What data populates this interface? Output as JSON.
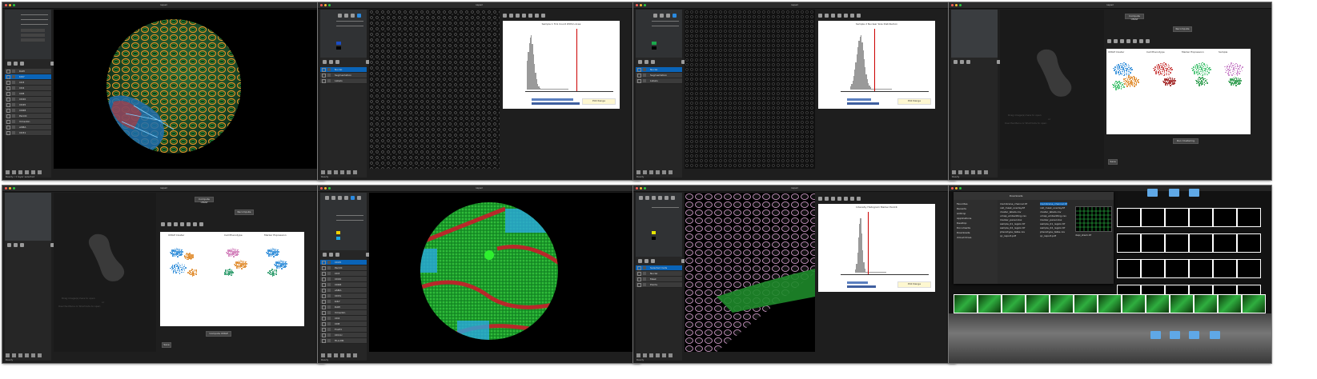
{
  "windows": [
    {
      "title": "napari",
      "status": "Ready / 1 layer selected",
      "layers": [
        "DAPI",
        "Ki67",
        "CD3",
        "CD4",
        "CD8",
        "CD20",
        "CD45",
        "CD68",
        "PanCK",
        "Vimentin",
        "aSMA",
        "CD31"
      ],
      "selected_layer": "Ki67"
    },
    {
      "title": "napari",
      "status": "Ready",
      "plot_title": "Sample 1 TLS Count Within Area",
      "button": "Plot Range",
      "layers": [
        "Nuclei",
        "Segmentation",
        "Labels"
      ],
      "selected_layer": "Nuclei"
    },
    {
      "title": "napari",
      "status": "Ready",
      "plot_title": "Sample 2 Nuclear Size Distribution",
      "button": "Plot Range",
      "layers": [
        "Nuclei",
        "Segmentation",
        "Labels"
      ],
      "selected_layer": "Nuclei"
    },
    {
      "title": "napari",
      "status": "Ready",
      "placeholder_line1": "Drag image(s) here to open",
      "placeholder_line2": "or",
      "placeholder_line3": "Use the Menu or Shortcuts to open",
      "umap_titles": [
        "UMAP Cluster",
        "Cell Phenotype",
        "Marker Expression",
        "Sample"
      ],
      "buttons": [
        "Compute UMAP",
        "Recompute",
        "Run Clustering",
        "Save"
      ]
    },
    {
      "title": "napari",
      "status": "Ready",
      "placeholder_line1": "Drag image(s) here to open",
      "placeholder_line2": "or",
      "placeholder_line3": "Use the Menu or Shortcuts to open",
      "umap_titles": [
        "UMAP Cluster",
        "Cell Phenotype",
        "Marker Expression"
      ],
      "buttons": [
        "Compute UMAP",
        "Recompute",
        "Save"
      ]
    },
    {
      "title": "napari",
      "status": "Ready",
      "layers": [
        "CD45",
        "PanCK",
        "CD3",
        "CD20",
        "CD68",
        "aSMA",
        "CD31",
        "Ki67",
        "DAPI",
        "Vimentin",
        "CD4",
        "CD8",
        "FoxP3",
        "CD11c",
        "HLA-DR"
      ],
      "selected_layer": "CD45"
    },
    {
      "title": "napari",
      "status": "Ready",
      "plot_title": "Intensity Histogram Marker PanCK",
      "button": "Plot Range",
      "layers": [
        "Selected Cells",
        "Nuclei",
        "Mask",
        "Points"
      ],
      "selected_layer": "Selected Cells"
    },
    {
      "title": "Downloads",
      "status": "",
      "files": [
        "membrane_channel.tif",
        "cell_mask_overlay.tif",
        "cluster_labels.csv",
        "umap_embedding.csv",
        "marker_panel.xlsx",
        "sample_01_region.tif",
        "sample_02_region.tif",
        "phenotype_table.csv",
        "qc_report.pdf"
      ],
      "selected_file": "dapi_stack.tif",
      "sidebar": [
        "Favorites",
        "Recents",
        "AirDrop",
        "Applications",
        "Desktop",
        "Documents",
        "Downloads",
        "iCloud Drive"
      ]
    }
  ]
}
